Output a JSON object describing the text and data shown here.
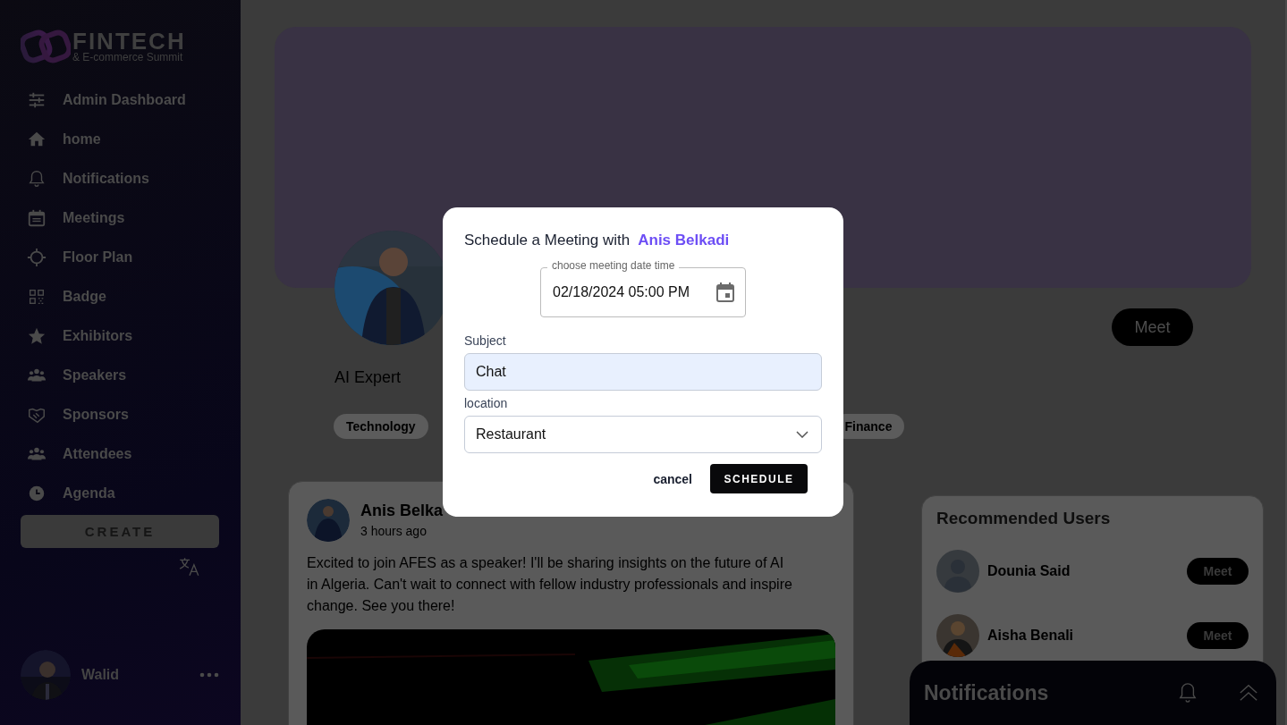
{
  "logo": {
    "title": "FINTECH",
    "subtitle": "& E-commerce Summit"
  },
  "sidebar": {
    "items": [
      {
        "label": "Admin Dashboard"
      },
      {
        "label": "home"
      },
      {
        "label": "Notifications"
      },
      {
        "label": "Meetings"
      },
      {
        "label": "Floor Plan"
      },
      {
        "label": "Badge"
      },
      {
        "label": "Exhibitors"
      },
      {
        "label": "Speakers"
      },
      {
        "label": "Sponsors"
      },
      {
        "label": "Attendees"
      },
      {
        "label": "Agenda"
      }
    ],
    "create_button": "CREATE",
    "user": {
      "name": "Walid"
    }
  },
  "profile": {
    "meet_button": "Meet",
    "role": "AI Expert",
    "tags": [
      "Technology",
      "Finance"
    ]
  },
  "post": {
    "author": "Anis Belka",
    "time": "3 hours ago",
    "text": "Excited to join AFES as a speaker! I'll be sharing insights on the future of AI in Algeria. Can't wait to connect with fellow industry professionals and inspire change. See you there!"
  },
  "recommended": {
    "title": "Recommended Users",
    "users": [
      {
        "name": "Dounia Said",
        "kind": "placeholder",
        "button": "Meet"
      },
      {
        "name": "Aisha Benali",
        "button": "Meet"
      }
    ]
  },
  "notifications_panel": {
    "title": "Notifications"
  },
  "dialog": {
    "title": "Schedule a Meeting with",
    "person": "Anis Belkadi",
    "date_label": "choose meeting date time",
    "date_value": "02/18/2024 05:00 PM",
    "subject_label": "Subject",
    "subject_value": "Chat",
    "location_label": "location",
    "location_value": "Restaurant",
    "cancel": "cancel",
    "schedule": "SCHEDULE"
  }
}
